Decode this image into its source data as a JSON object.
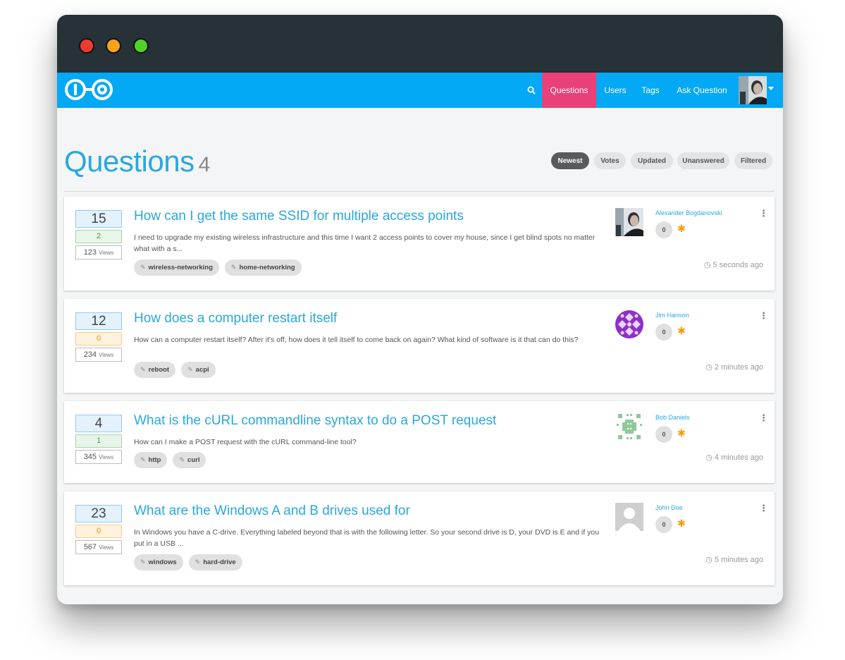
{
  "window": {
    "buttons": [
      "close",
      "minimize",
      "maximize"
    ]
  },
  "nav": {
    "search_icon": "search-icon",
    "links": [
      {
        "label": "Questions",
        "active": true
      },
      {
        "label": "Users",
        "active": false
      },
      {
        "label": "Tags",
        "active": false
      },
      {
        "label": "Ask Question",
        "active": false
      }
    ]
  },
  "page": {
    "title": "Questions",
    "count": "4"
  },
  "filters": [
    "Newest",
    "Votes",
    "Updated",
    "Unanswered",
    "Filtered"
  ],
  "active_filter": "Newest",
  "colors": {
    "nav": "#03a9f4",
    "active": "#e9407a",
    "link": "#29a8df",
    "titlebar": "#263238"
  },
  "questions": [
    {
      "votes": "15",
      "answers": "2",
      "answers_state": "green",
      "views": "123",
      "views_label": "Views",
      "title": "How can I get the same SSID for multiple access points",
      "excerpt": "I need to upgrade my existing wireless infrastructure and this time I want 2 access points to cover my house, since I get blind spots no matter what with a s...",
      "tags": [
        "wireless-networking",
        "home-networking"
      ],
      "author": "Alexander Bogdanovski",
      "reputation": "0",
      "time": "5 seconds ago"
    },
    {
      "votes": "12",
      "answers": "0",
      "answers_state": "orange",
      "views": "234",
      "views_label": "Views",
      "title": "How does a computer restart itself",
      "excerpt": "How can a computer restart itself? After it's off, how does it tell itself to come back on again? What kind of software is it that can do this?",
      "tags": [
        "reboot",
        "acpi"
      ],
      "author": "Jim Hanson",
      "reputation": "0",
      "time": "2 minutes ago"
    },
    {
      "votes": "4",
      "answers": "1",
      "answers_state": "green",
      "views": "345",
      "views_label": "Views",
      "title": "What is the cURL commandline syntax to do a POST request",
      "excerpt": "How can I make a POST request with the cURL command-line tool?",
      "tags": [
        "http",
        "curl"
      ],
      "author": "Bob Daniels",
      "reputation": "0",
      "time": "4 minutes ago"
    },
    {
      "votes": "23",
      "answers": "0",
      "answers_state": "orange",
      "views": "567",
      "views_label": "Views",
      "title": "What are the Windows A and B drives used for",
      "excerpt": "In Windows you have a C-drive. Everything labeled beyond that is with the following letter. So your second drive is D, your DVD is E and if you put in a USB ...",
      "tags": [
        "windows",
        "hard-drive"
      ],
      "author": "John Doe",
      "reputation": "0",
      "time": "5 minutes ago"
    }
  ]
}
